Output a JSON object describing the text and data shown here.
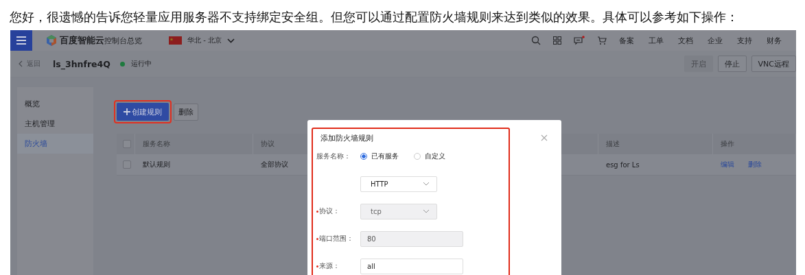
{
  "intro": "您好，很遗憾的告诉您轻量应用服务器不支持绑定安全组。但您可以通过配置防火墙规则来达到类似的效果。具体可以参考如下操作：",
  "header": {
    "brand": "百度智能云",
    "console": "控制台总览",
    "region": "华北 - 北京",
    "message_unread": true,
    "links": [
      "备案",
      "工单",
      "文档",
      "企业",
      "支持",
      "财务"
    ]
  },
  "instance": {
    "back": "返回",
    "name": "ls_3hnfre4Q",
    "status": "运行中",
    "actions": [
      {
        "label": "开启",
        "disabled": true
      },
      {
        "label": "停止",
        "disabled": false
      },
      {
        "label": "VNC远程",
        "disabled": false
      }
    ]
  },
  "sidebar": {
    "items": [
      {
        "label": "概览",
        "selected": false
      },
      {
        "label": "主机管理",
        "selected": false
      },
      {
        "label": "防火墙",
        "selected": true
      }
    ]
  },
  "toolbar": {
    "create": {
      "label": "创建规则",
      "highlighted": true
    },
    "delete": "删除"
  },
  "table": {
    "header_checked": false,
    "columns": [
      "服务名称",
      "协议",
      "描述",
      "操作"
    ],
    "rows": [
      {
        "checked": false,
        "cells": [
          "默认规则",
          "全部协议",
          "esg for Ls"
        ],
        "actions": [
          "编辑",
          "删除"
        ]
      }
    ]
  },
  "dialog": {
    "title": "添加防火墙规则",
    "highlighted": true,
    "fields": [
      {
        "kind": "radio",
        "label": "服务名称：",
        "options": [
          {
            "label": "已有服务",
            "selected": true
          },
          {
            "label": "自定义",
            "selected": false
          }
        ]
      },
      {
        "kind": "select",
        "value": "HTTP",
        "disabled": false
      },
      {
        "kind": "select",
        "label": "协议：",
        "required": true,
        "value": "tcp",
        "disabled": true
      },
      {
        "kind": "input",
        "label": "端口范围：",
        "required": true,
        "value": "80",
        "disabled": true
      },
      {
        "kind": "input",
        "label": "来源：",
        "required": true,
        "value": "all",
        "disabled": false
      }
    ]
  }
}
